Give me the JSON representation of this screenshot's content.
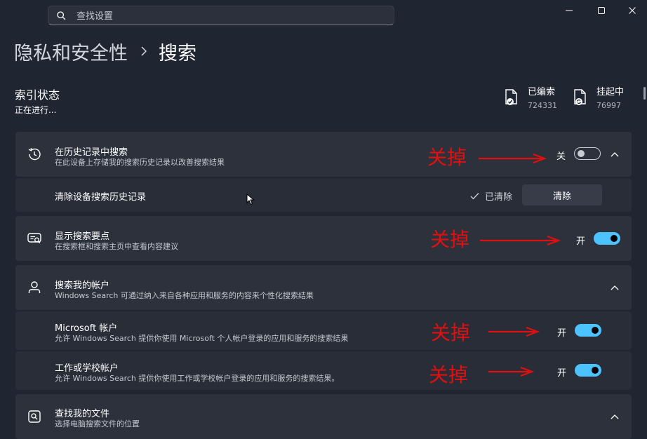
{
  "search": {
    "placeholder": "查找设置"
  },
  "breadcrumb": {
    "parent": "隐私和安全性",
    "current": "搜索"
  },
  "indexing": {
    "title": "索引状态",
    "status": "正在进行...",
    "indexed_label": "已编索",
    "indexed_count": "724331",
    "pending_label": "挂起中",
    "pending_count": "76997"
  },
  "history": {
    "title": "在历史记录中搜索",
    "desc": "在此设备上存储我的搜索历史记录以改善搜索结果",
    "state": "关",
    "on": false
  },
  "clear_history": {
    "title": "清除设备搜索历史记录",
    "status": "已清除",
    "button": "清除"
  },
  "highlights": {
    "title": "显示搜索要点",
    "desc": "在搜索框和搜索主页中查看内容建议",
    "state": "开",
    "on": true
  },
  "accounts": {
    "title": "搜索我的帐户",
    "desc": "Windows Search 可通过纳入来自各种应用和服务的内容来个性化搜索结果"
  },
  "microsoft_account": {
    "title": "Microsoft 帐户",
    "desc": "允许 Windows Search 提供你使用 Microsoft 个人帐户登录的应用和服务的搜索结果",
    "state": "开",
    "on": true
  },
  "work_account": {
    "title": "工作或学校帐户",
    "desc": "允许 Windows Search 提供你使用工作或学校帐户登录的应用和服务的搜索结果。",
    "state": "开",
    "on": true
  },
  "find_files": {
    "title": "查找我的文件",
    "desc": "选择电脑搜索文件的位置"
  },
  "annotations": {
    "text": "关掉"
  },
  "colors": {
    "accent": "#4cc2ff",
    "annotation": "#e01010",
    "background": "#202532",
    "card": "#2c313c"
  }
}
